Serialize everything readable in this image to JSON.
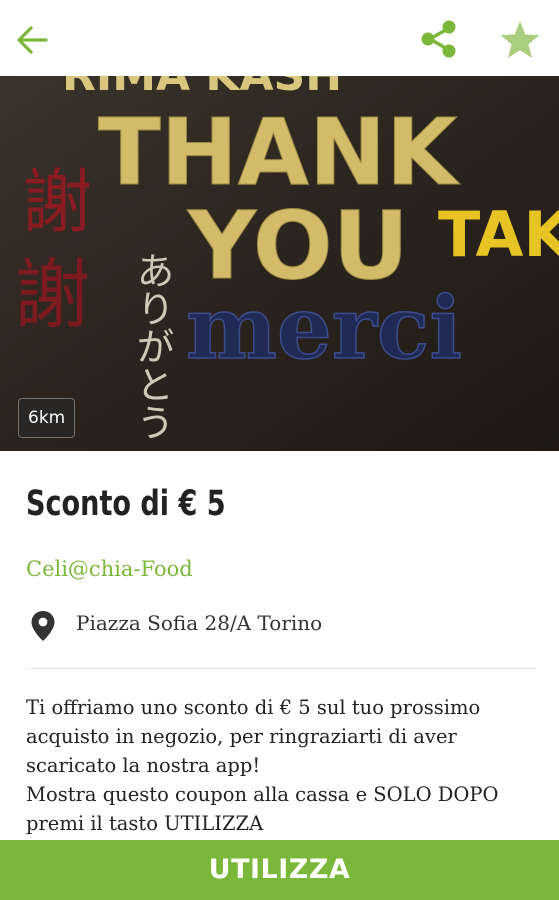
{
  "colors": {
    "accent": "#7bb83a",
    "text": "#222222",
    "badge_bg": "#3a3a3a"
  },
  "topbar": {
    "back_icon": "arrow-left-icon",
    "share_icon": "share-icon",
    "favorite_icon": "star-icon"
  },
  "hero": {
    "text_thank": "THANK",
    "text_you": "YOU",
    "text_take": "TAKE",
    "text_top": "RIMA KASH",
    "text_merci": "merci",
    "text_kanji_1": "謝",
    "text_kanji_2": "謝",
    "text_kana": "ありがとう",
    "distance": "6km"
  },
  "offer": {
    "title": "Sconto di € 5",
    "merchant": "Celi@chia-Food",
    "address": "Piazza Sofia 28/A Torino",
    "description_lines": [
      "Ti offriamo uno sconto di € 5 sul tuo prossimo",
      "acquisto in negozio, per ringraziarti di aver",
      "scaricato la nostra app!",
      "Mostra questo coupon alla cassa e SOLO DOPO",
      "premi il tasto UTILIZZA"
    ]
  },
  "cta": {
    "label": "UTILIZZA"
  }
}
